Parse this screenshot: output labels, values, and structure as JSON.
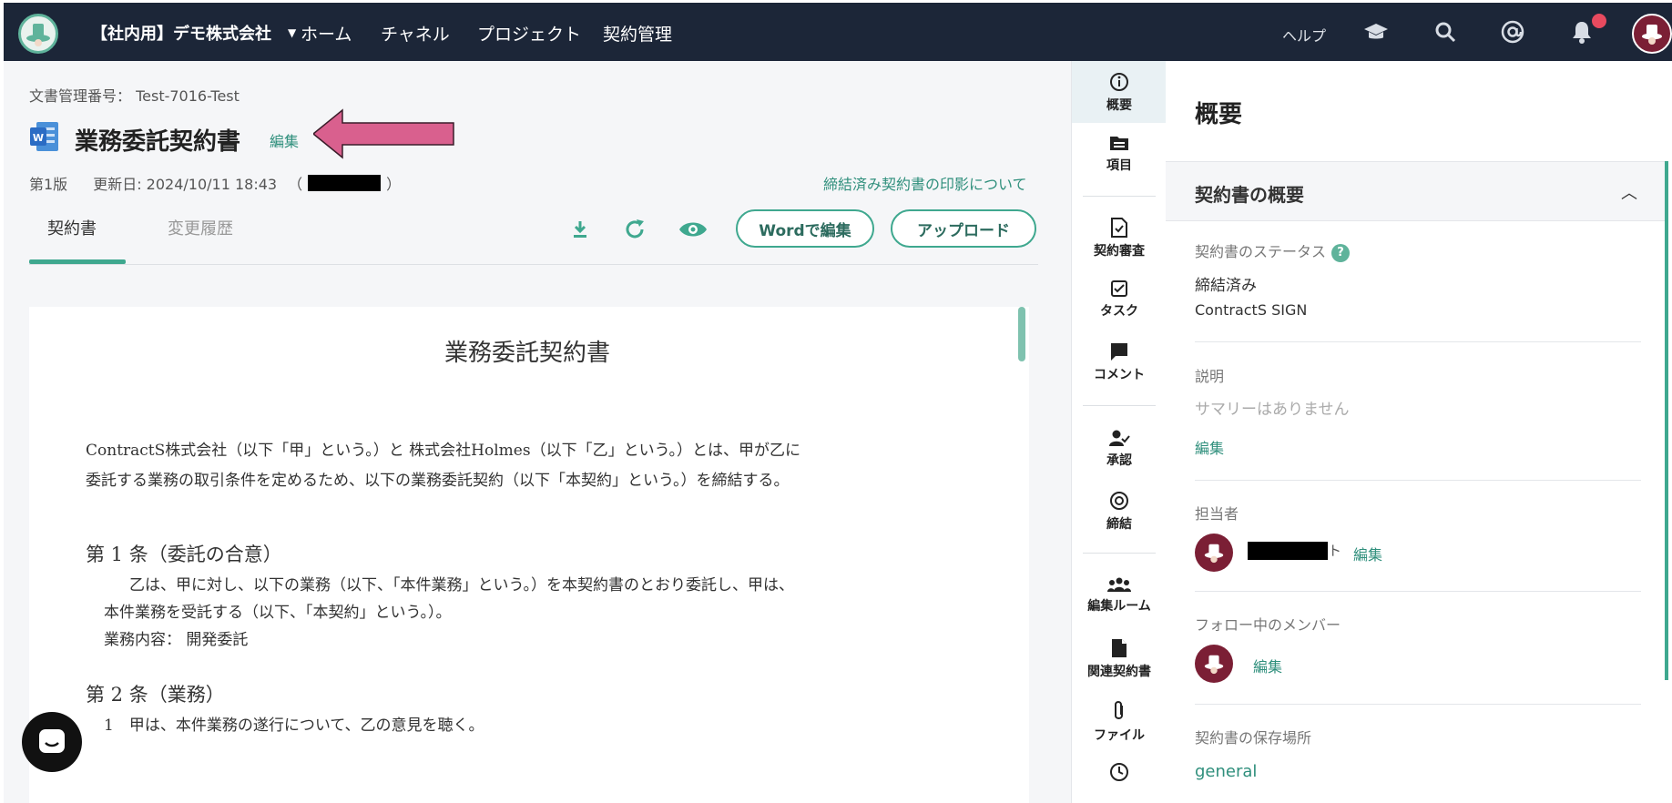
{
  "topbar": {
    "company": "【社内用】デモ株式会社",
    "nav": [
      "ホーム",
      "チャネル",
      "プロジェクト",
      "契約管理"
    ],
    "help": "ヘルプ"
  },
  "doc": {
    "number_label": "文書管理番号： Test-7016-Test",
    "title": "業務委託契約書",
    "edit": "編集",
    "version": "第1版",
    "updated": "更新日: 2024/10/11 18:43",
    "paren_open": "（",
    "paren_close": "）",
    "seal_link": "締結済み契約書の印影について",
    "tabs": [
      "契約書",
      "変更履歴"
    ],
    "btn_word": "Wordで編集",
    "btn_upload": "アップロード"
  },
  "contract": {
    "heading": "業務委託契約書",
    "intro_1": "ContractS株式会社（以下「甲」という。）と 株式会社Holmes（以下「乙」という。）とは、甲が乙に",
    "intro_2": "委託する業務の取引条件を定めるため、以下の業務委託契約（以下「本契約」という。）を締結する。",
    "article1": "第 1 条（委託の合意）",
    "art1_1": "乙は、甲に対し、以下の業務（以下、「本件業務」という。）を本契約書のとおり委託し、甲は、",
    "art1_2": "本件業務を受託する（以下、「本契約」という。）。",
    "art1_3": "業務内容： 開発委託",
    "article2": "第 2 条（業務）",
    "art2_1": "1　甲は、本件業務の遂行について、乙の意見を聴く。"
  },
  "strip": {
    "items": [
      "概要",
      "項目",
      "契約審査",
      "タスク",
      "コメント",
      "承認",
      "締結",
      "編集ルーム",
      "関連契約書",
      "ファイル"
    ]
  },
  "panel": {
    "title": "概要",
    "section": "契約書の概要",
    "status_label": "契約書のステータス",
    "status_value": "締結済み",
    "status_sub": "ContractS SIGN",
    "desc_label": "説明",
    "desc_value": "サマリーはありません",
    "edit": "編集",
    "owner_label": "担当者",
    "owner_suffix": "ト",
    "followers_label": "フォロー中のメンバー",
    "storage_label": "契約書の保存場所",
    "storage_value": "general"
  },
  "colors": {
    "accent": "#3fa88f",
    "topbar": "#1c2638",
    "arrow": "#d9608e"
  }
}
